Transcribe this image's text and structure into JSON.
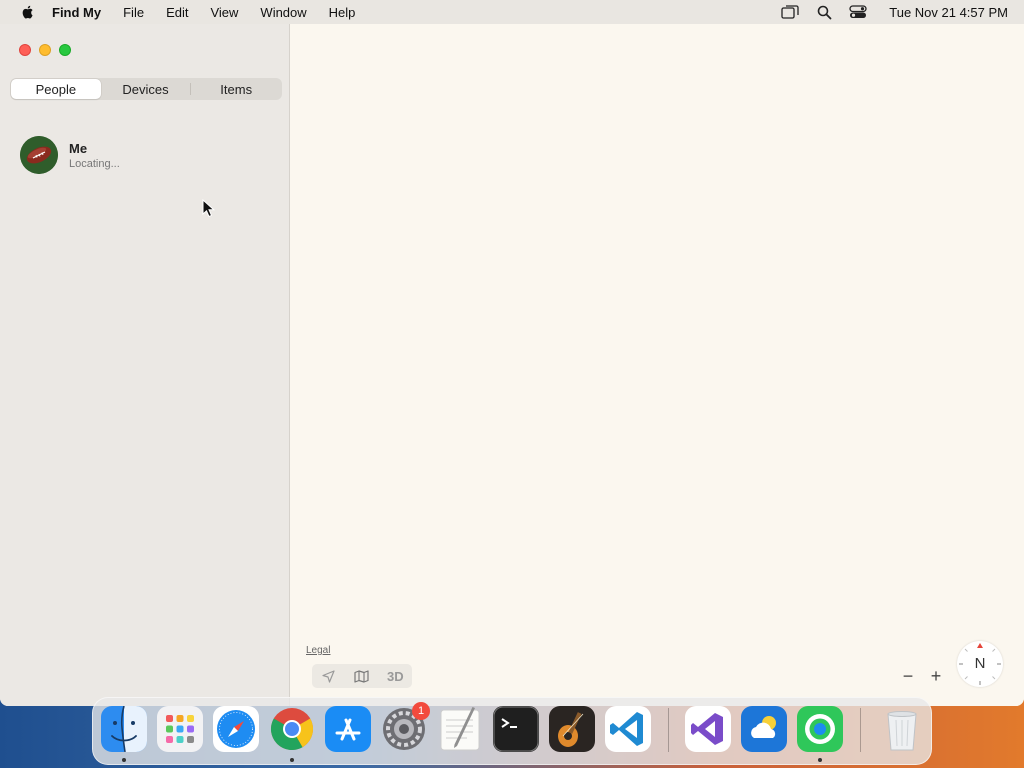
{
  "menubar": {
    "app_name": "Find My",
    "items": [
      "File",
      "Edit",
      "View",
      "Window",
      "Help"
    ],
    "clock": "Tue Nov 21  4:57 PM"
  },
  "sidebar": {
    "tabs": [
      {
        "label": "People",
        "active": true
      },
      {
        "label": "Devices",
        "active": false
      },
      {
        "label": "Items",
        "active": false
      }
    ],
    "people": [
      {
        "name": "Me",
        "status": "Locating..."
      }
    ]
  },
  "map": {
    "legal_label": "Legal",
    "view_3d_label": "3D",
    "zoom_out_label": "−",
    "zoom_in_label": "+",
    "compass_label": "N"
  },
  "dock": {
    "apps": [
      "finder-icon",
      "launchpad-icon",
      "safari-icon",
      "chrome-icon",
      "app-store-icon",
      "system-settings-icon",
      "textedit-icon",
      "terminal-icon",
      "garageband-icon",
      "vscode-icon",
      "visual-studio-icon",
      "weather-icon",
      "find-my-icon",
      "trash-icon"
    ],
    "settings_badge": "1"
  },
  "colors": {
    "accent_blue": "#1a6ff0",
    "close": "#fe5f57",
    "minimize": "#febc2e",
    "maximize": "#28c840",
    "badge": "#f24a3d"
  }
}
